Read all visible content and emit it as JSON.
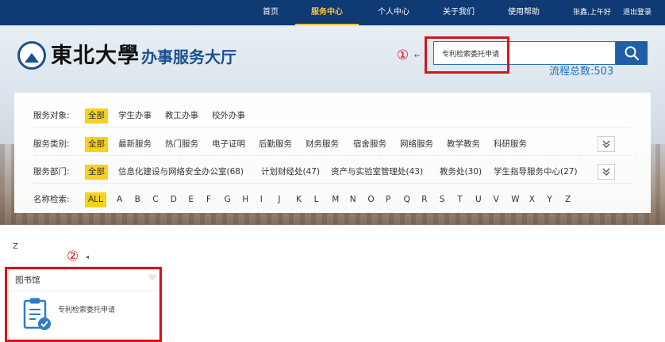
{
  "nav": {
    "items": [
      "首页",
      "服务中心",
      "个人中心",
      "关于我们",
      "使用帮助"
    ],
    "active_index": 1,
    "user": "张鑫,上午好",
    "logout": "退出登录",
    "bg_color": "#0f3a73",
    "active_color": "#f6c342"
  },
  "header": {
    "logo_text": "東北大學",
    "title": "办事服务大厅",
    "logo_icon": "university-seal-icon"
  },
  "search": {
    "value": "专利检索委托申请",
    "button_icon": "search-icon",
    "total": "流程总数:503"
  },
  "annotations": {
    "marker1": "①",
    "marker2": "②",
    "arrow": "←",
    "arrow2": "◂",
    "highlight_color": "#d6141a"
  },
  "filters": {
    "target": {
      "label": "服务对象:",
      "options": [
        "全部",
        "学生办事",
        "教工办事",
        "校外办事"
      ],
      "selected": 0
    },
    "category": {
      "label": "服务类别:",
      "options": [
        "全部",
        "最新服务",
        "热门服务",
        "电子证明",
        "后勤服务",
        "财务服务",
        "宿舍服务",
        "网络服务",
        "教学教务",
        "科研服务"
      ],
      "selected": 0
    },
    "department": {
      "label": "服务部门:",
      "options": [
        "全部",
        "信息化建设与网络安全办公室(68)",
        "计划财经处(47)",
        "资产与实验室管理处(43)",
        "教务处(30)",
        "学生指导服务中心(27)"
      ],
      "selected": 0
    },
    "name": {
      "label": "名称检索:",
      "options": [
        "ALL",
        "A",
        "B",
        "C",
        "D",
        "E",
        "F",
        "G",
        "H",
        "I",
        "J",
        "K",
        "L",
        "M",
        "N",
        "O",
        "P",
        "Q",
        "R",
        "S",
        "T",
        "U",
        "V",
        "W",
        "X",
        "Y",
        "Z"
      ],
      "selected": 0
    },
    "expand_icon": "double-chevron-down-icon",
    "selected_color": "#f6d21c"
  },
  "results": {
    "group_letter": "Z",
    "card": {
      "title": "图书馆",
      "item": "专利检索委托申请",
      "icon": "clipboard-check-icon",
      "fav_icon": "heart-icon"
    }
  }
}
